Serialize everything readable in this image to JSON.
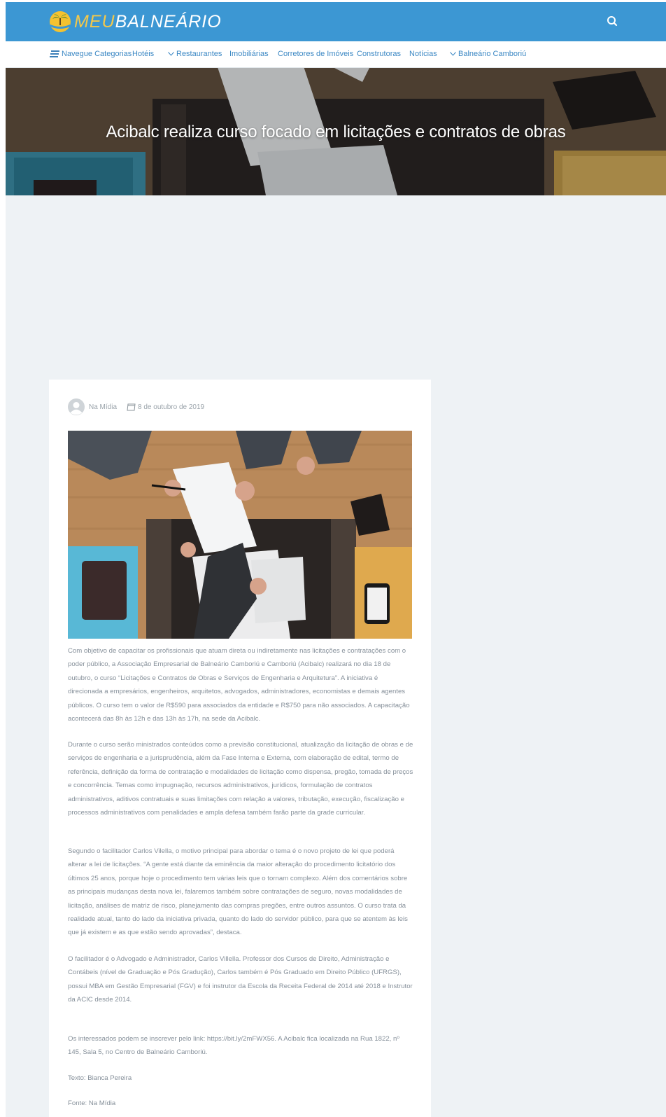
{
  "header": {
    "logo_meu": "MEU",
    "logo_balneario": "BALNEÁRIO",
    "brand_color": "#3c97d3"
  },
  "nav": {
    "items": [
      {
        "label": "Navegue Categorias",
        "icon": "menu-lines-icon"
      },
      {
        "label": "Hotéis"
      },
      {
        "label": "Restaurantes",
        "icon": "chevron-down-icon"
      },
      {
        "label": "Imobiliárias"
      },
      {
        "label": "Corretores de Imóveis"
      },
      {
        "label": "Construtoras"
      },
      {
        "label": "Notícias"
      },
      {
        "label": "Balneário Camboriú",
        "icon": "chevron-down-icon"
      }
    ]
  },
  "hero": {
    "title": "Acibalc realiza curso focado em licitações e contratos de obras"
  },
  "post": {
    "author": "Na Mídia",
    "date": "8 de outubro de 2019",
    "paragraphs": [
      "Com objetivo de capacitar os profissionais que atuam direta ou indiretamente nas licitações e contratações com o poder público, a Associação Empresarial de Balneário Camboriú e Camboriú (Acibalc) realizará no dia 18 de outubro, o curso “Licitações e Contratos de Obras e Serviços de Engenharia e Arquitetura”. A iniciativa é direcionada a empresários, engenheiros, arquitetos, advogados, administradores, economistas e demais agentes públicos. O curso tem o valor de R$590 para associados da entidade e R$750 para não associados. A capacitação acontecerá das 8h às 12h e das 13h às 17h, na sede da Acibalc.",
      "Durante o curso serão ministrados conteúdos como a previsão constitucional, atualização da licitação de obras e de serviços de engenharia e a jurisprudência, além da Fase Interna e Externa, com elaboração de edital, termo de referência, definição da forma de contratação e modalidades de licitação como dispensa, pregão, tomada de preços e concorrência. Temas como impugnação, recursos administrativos, jurídicos, formulação de contratos administrativos, aditivos contratuais e suas limitações com relação a valores, tributação, execução, fiscalização e processos administrativos com penalidades e ampla defesa também farão parte da grade curricular.",
      "Segundo o facilitador Carlos Vilella, o motivo principal para abordar o tema é o novo projeto de lei que poderá alterar a lei de licitações. “A gente está diante da eminência da maior alteração do procedimento licitatório dos últimos 25 anos, porque hoje o procedimento tem várias leis que o tornam complexo. Além dos comentários sobre as principais mudanças desta nova lei, falaremos também sobre contratações de seguro, novas modalidades de licitação, análises de matriz de risco, planejamento das compras pregões, entre outros assuntos. O curso trata da realidade atual, tanto do lado da iniciativa privada, quanto do lado do servidor público, para que se atentem às leis que já existem e as que estão sendo aprovadas”, destaca.",
      "O facilitador é o Advogado e Administrador, Carlos Villella. Professor dos Cursos de Direito, Administração e Contábeis (nível de Graduação e Pós Gradução), Carlos também é Pós Graduado em Direito Público (UFRGS), possui MBA em Gestão Empresarial (FGV) e foi instrutor da Escola da Receita Federal de 2014 até 2018 e Instrutor da ACIC desde 2014.",
      "Os interessados podem se inscrever pelo link: https://bit.ly/2mFWX56. A Acibalc fica localizada na Rua 1822, nº 145, Sala 5, no Centro de Balneário Camboriú.",
      "Texto: Bianca Pereira",
      "Fonte: Na Mídia"
    ]
  }
}
